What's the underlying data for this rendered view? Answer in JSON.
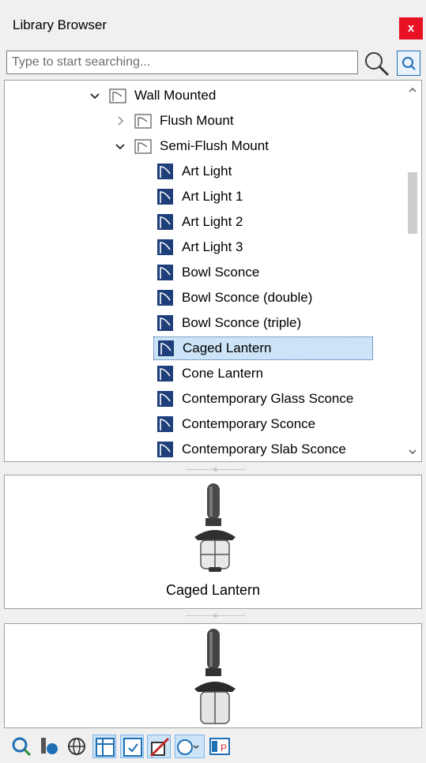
{
  "window": {
    "title": "Library Browser",
    "close_label": "x"
  },
  "search": {
    "placeholder": "Type to start searching..."
  },
  "tree": {
    "items": [
      {
        "label": "Wall Mounted",
        "level": 0,
        "expander": "expanded",
        "kind": "folder"
      },
      {
        "label": "Flush Mount",
        "level": 1,
        "expander": "collapsed",
        "kind": "folder"
      },
      {
        "label": "Semi-Flush Mount",
        "level": 1,
        "expander": "expanded",
        "kind": "folder"
      },
      {
        "label": "Art Light",
        "level": 2,
        "kind": "item"
      },
      {
        "label": "Art Light 1",
        "level": 2,
        "kind": "item"
      },
      {
        "label": "Art Light 2",
        "level": 2,
        "kind": "item"
      },
      {
        "label": "Art Light 3",
        "level": 2,
        "kind": "item"
      },
      {
        "label": "Bowl Sconce",
        "level": 2,
        "kind": "item"
      },
      {
        "label": "Bowl Sconce (double)",
        "level": 2,
        "kind": "item"
      },
      {
        "label": "Bowl Sconce (triple)",
        "level": 2,
        "kind": "item"
      },
      {
        "label": "Caged Lantern",
        "level": 2,
        "kind": "item",
        "selected": true
      },
      {
        "label": "Cone Lantern",
        "level": 2,
        "kind": "item"
      },
      {
        "label": "Contemporary Glass Sconce",
        "level": 2,
        "kind": "item"
      },
      {
        "label": "Contemporary Sconce",
        "level": 2,
        "kind": "item"
      },
      {
        "label": "Contemporary Slab Sconce",
        "level": 2,
        "kind": "item"
      }
    ]
  },
  "preview": {
    "caption": "Caged Lantern"
  },
  "toolbar": {
    "buttons": [
      {
        "icon": "refresh-library-icon",
        "active": false
      },
      {
        "icon": "fixture-library-icon",
        "active": false
      },
      {
        "icon": "globe-library-icon",
        "active": false
      },
      {
        "icon": "show-table-icon",
        "active": true
      },
      {
        "icon": "show-checked-icon",
        "active": true
      },
      {
        "icon": "material-slash-icon",
        "active": true
      },
      {
        "icon": "filter-dropdown-icon",
        "active": true
      },
      {
        "icon": "ep-icon",
        "active": false
      }
    ]
  },
  "colors": {
    "close_red": "#e81123",
    "selection_blue": "#cce4f7",
    "item_icon_navy": "#1e3f7a",
    "accent_blue": "#1f6fb5"
  }
}
